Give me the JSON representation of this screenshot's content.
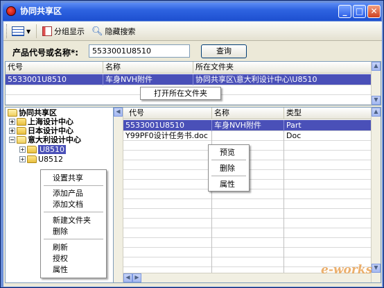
{
  "window": {
    "title": "协同共享区"
  },
  "toolbar": {
    "grouped_label": "分组显示",
    "hide_search_label": "隐藏搜索"
  },
  "search": {
    "label": "产品代号或名称*:",
    "value": "5533001U8510",
    "button_label": "查询"
  },
  "results": {
    "columns": [
      "代号",
      "名称",
      "所在文件夹"
    ],
    "rows": [
      {
        "code": "5533001U8510",
        "name": "车身NVH附件",
        "folder": "协同共享区\\意大利设计中心\\U8510"
      }
    ],
    "context_menu": {
      "open_folder": "打开所在文件夹"
    }
  },
  "tree": {
    "root": "协同共享区",
    "nodes": [
      {
        "label": "上海设计中心",
        "expanded": false
      },
      {
        "label": "日本设计中心",
        "expanded": false
      },
      {
        "label": "意大利设计中心",
        "expanded": true
      }
    ],
    "children": [
      {
        "label": "U8510",
        "selected": true
      },
      {
        "label": "U8512",
        "selected": false
      }
    ],
    "context_menu": {
      "items": [
        "设置共享",
        "添加产品",
        "添加文档",
        "新建文件夹",
        "删除",
        "刷新",
        "授权",
        "属性"
      ]
    }
  },
  "files": {
    "columns": [
      "代号",
      "名称",
      "类型"
    ],
    "rows": [
      {
        "code": "5533001U8510",
        "name": "车身NVH附件",
        "type": "Part"
      },
      {
        "code": "Y99PF0设计任务书.doc",
        "name": "",
        "type": "Doc"
      }
    ],
    "context_menu": {
      "items": [
        "预览",
        "删除",
        "属性"
      ]
    }
  },
  "watermark": "e-works",
  "colors": {
    "title_bar": "#2e63e0",
    "selection": "#4a50b8",
    "window_bg": "#ece9d8"
  }
}
